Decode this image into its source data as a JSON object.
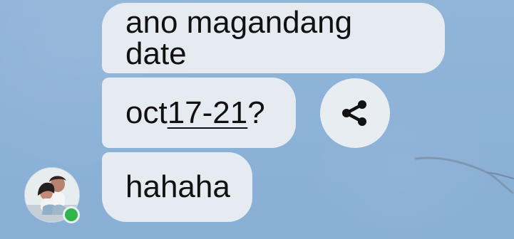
{
  "chat": {
    "messages": [
      {
        "text": "ano magandang date"
      },
      {
        "prefix": "oct ",
        "link_text": "17-21",
        "suffix": "?"
      },
      {
        "text": "hahaha"
      }
    ]
  },
  "icons": {
    "share": "share-icon",
    "avatar": "avatar",
    "status": "online-status-dot"
  },
  "colors": {
    "background": "#8db2d7",
    "bubble": "#e5ebf1",
    "share_button": "#e8edf2",
    "online_status": "#31b44b"
  }
}
